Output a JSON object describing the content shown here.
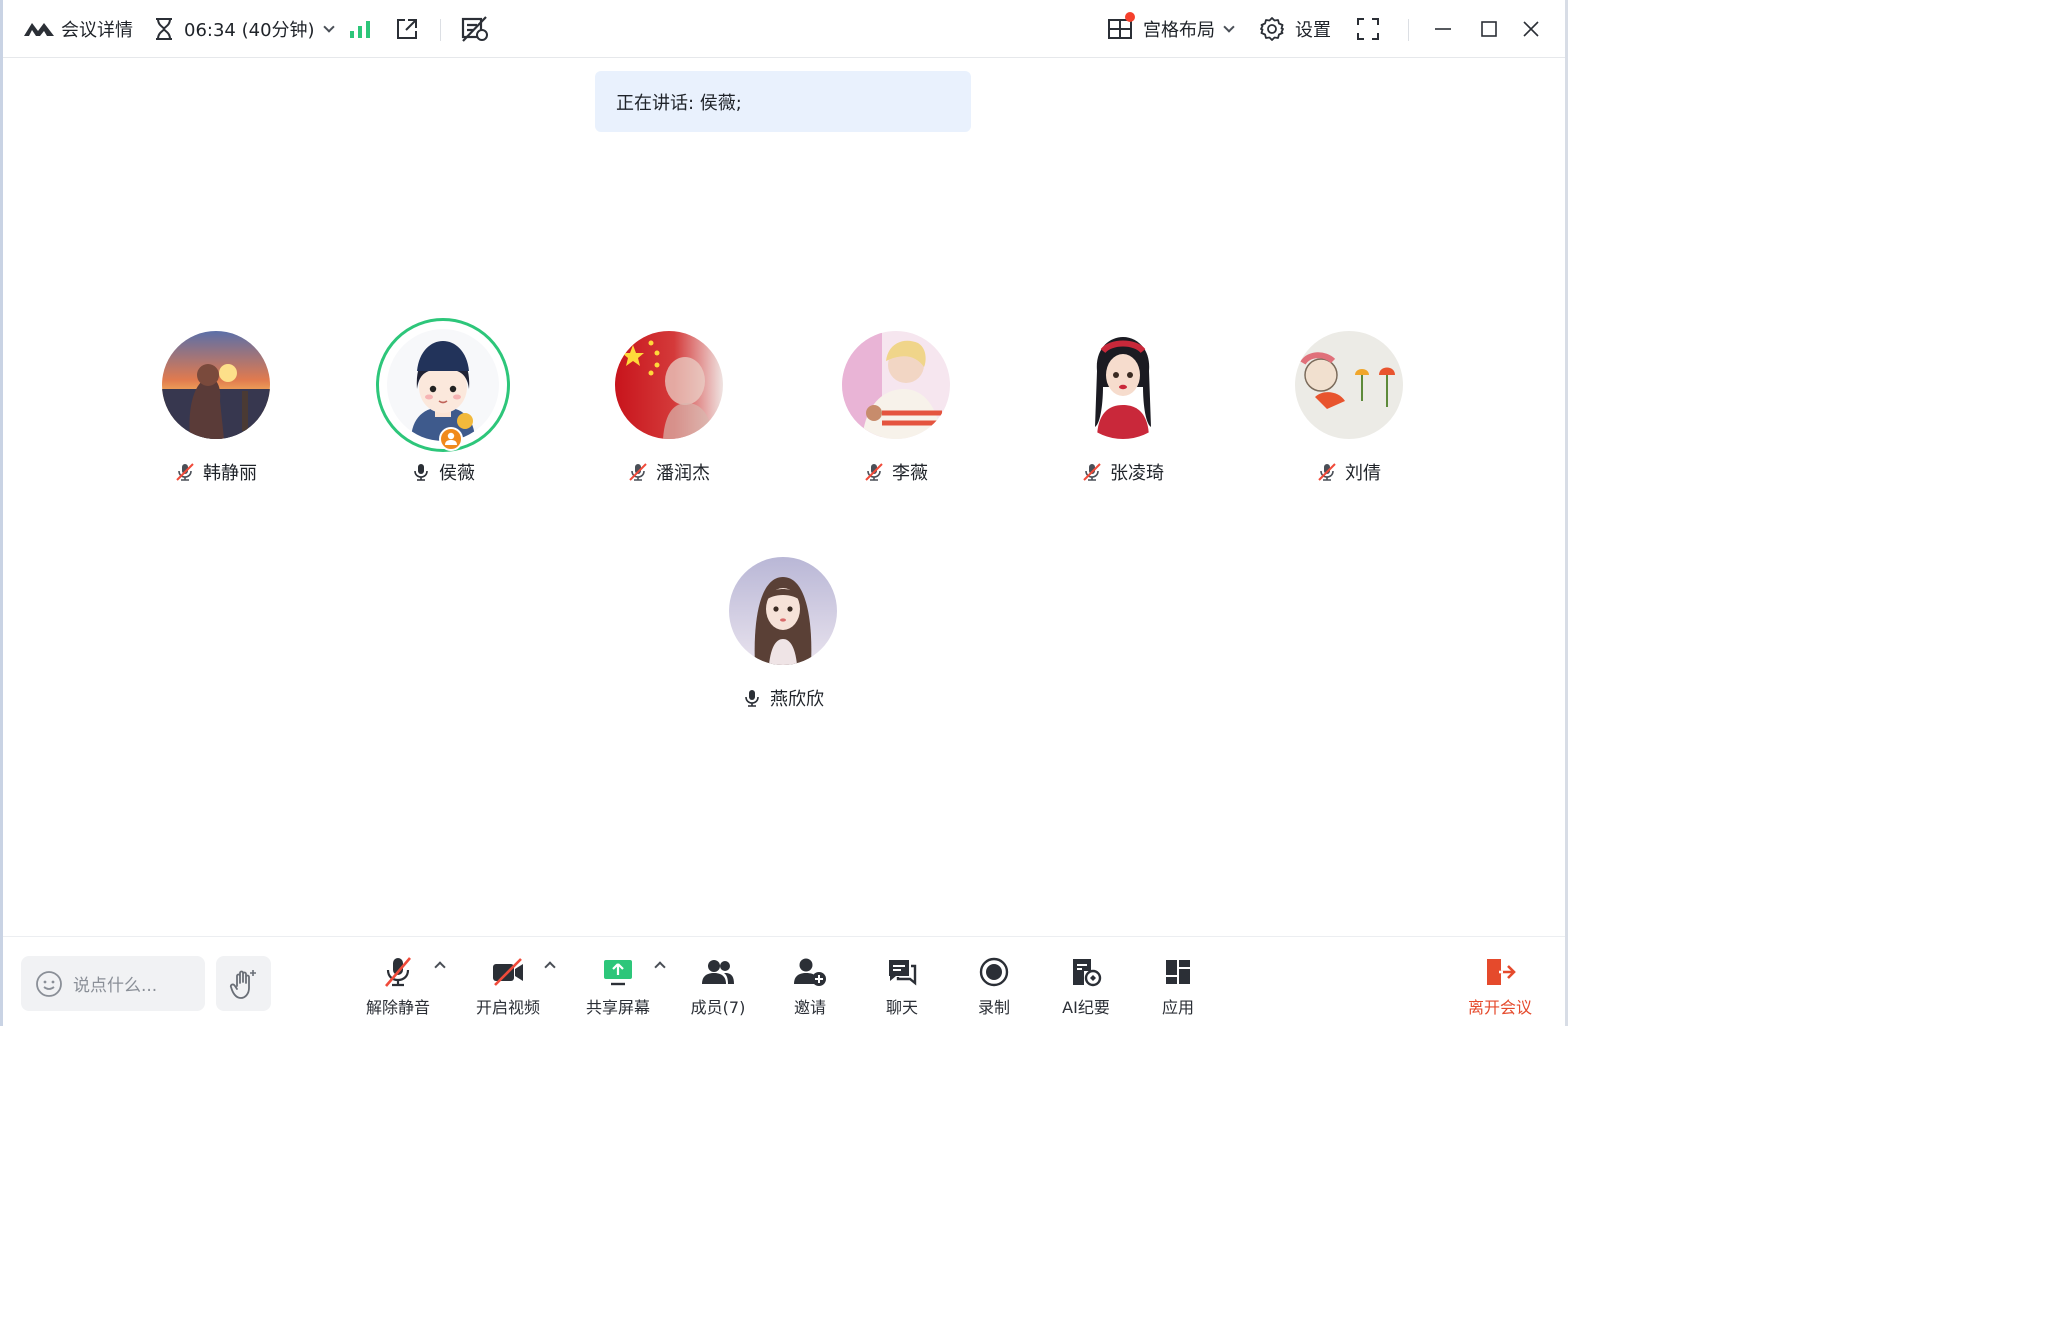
{
  "titlebar": {
    "meeting_details": "会议详情",
    "timer": "06:34 (40分钟)",
    "layout_label": "宫格布局",
    "settings_label": "设置"
  },
  "speaking_banner": "正在讲话: 侯薇;",
  "participants": [
    {
      "name": "韩静丽",
      "mic": "muted"
    },
    {
      "name": "侯薇",
      "mic": "on",
      "speaking": true,
      "host": true
    },
    {
      "name": "潘润杰",
      "mic": "muted"
    },
    {
      "name": "李薇",
      "mic": "muted"
    },
    {
      "name": "张凌琦",
      "mic": "muted"
    },
    {
      "name": "刘倩",
      "mic": "muted"
    },
    {
      "name": "燕欣欣",
      "mic": "on"
    }
  ],
  "toolbar": {
    "chat_placeholder": "说点什么...",
    "unmute": "解除静音",
    "start_video": "开启视频",
    "share_screen": "共享屏幕",
    "members": "成员(7)",
    "invite": "邀请",
    "chat": "聊天",
    "record": "录制",
    "ai_minutes": "AI纪要",
    "apps": "应用",
    "leave": "离开会议"
  },
  "colors": {
    "speaking_ring": "#2dc67a",
    "signal": "#2dc67a",
    "share_screen": "#2dc67a",
    "leave": "#e54a2c",
    "banner_bg": "#e9f1fd",
    "notification_dot": "#f5402c"
  },
  "icons": [
    "logo-icon",
    "hourglass-icon",
    "signal-icon",
    "external-link-icon",
    "subtitle-off-icon",
    "grid-layout-icon",
    "gear-icon",
    "fullscreen-icon",
    "minimize-icon",
    "maximize-icon",
    "close-icon",
    "mic-muted-icon",
    "mic-icon",
    "emoji-icon",
    "raise-hand-icon",
    "video-off-icon",
    "share-screen-icon",
    "members-icon",
    "invite-icon",
    "chat-icon",
    "record-icon",
    "ai-minutes-icon",
    "apps-icon",
    "leave-icon"
  ]
}
